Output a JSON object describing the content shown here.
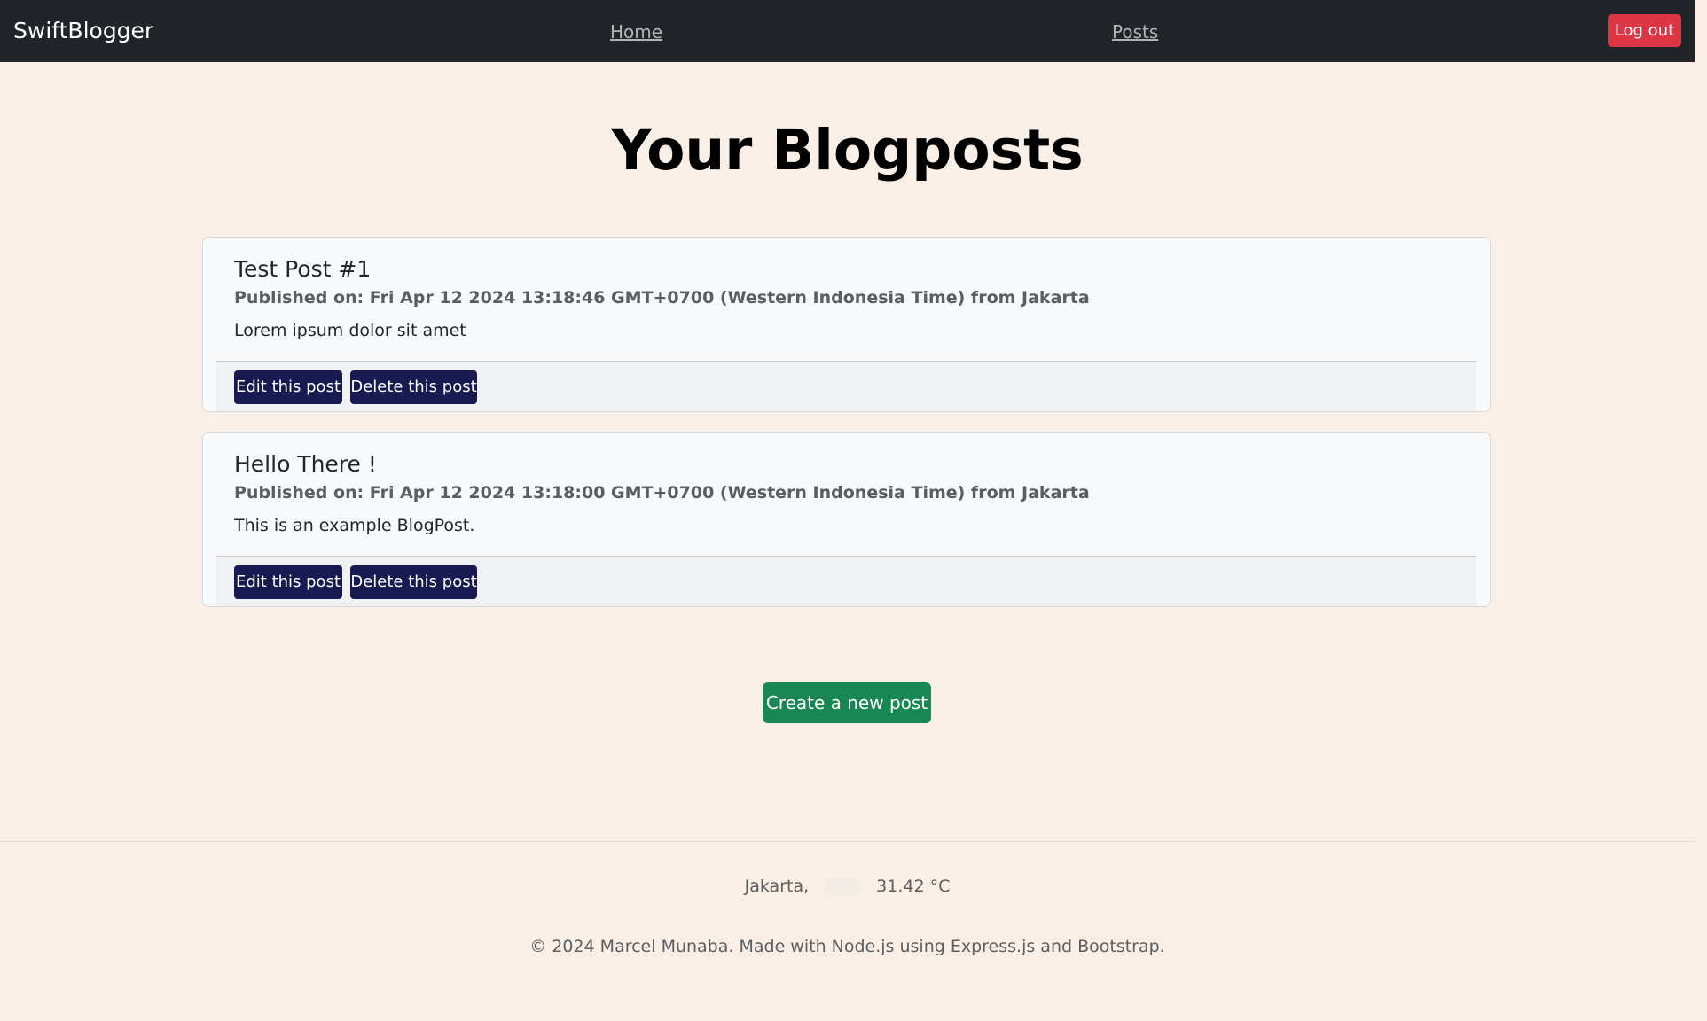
{
  "navbar": {
    "brand": "SwiftBlogger",
    "links": [
      {
        "label": "Home"
      },
      {
        "label": "Posts"
      }
    ],
    "logout_label": "Log out"
  },
  "page": {
    "title": "Your Blogposts"
  },
  "posts": [
    {
      "title": "Test Post #1",
      "published": "Published on: Fri Apr 12 2024 13:18:46 GMT+0700 (Western Indonesia Time) from Jakarta",
      "body": "Lorem ipsum dolor sit amet",
      "edit_label": "Edit this post",
      "delete_label": "Delete this post"
    },
    {
      "title": "Hello There !",
      "published": "Published on: Fri Apr 12 2024 13:18:00 GMT+0700 (Western Indonesia Time) from Jakarta",
      "body": "This is an example BlogPost.",
      "edit_label": "Edit this post",
      "delete_label": "Delete this post"
    }
  ],
  "create_label": "Create a new post",
  "footer": {
    "city": "Jakarta,",
    "weather_icon": "weather-icon",
    "temperature": "31.42 °C",
    "copyright": "© 2024 Marcel Munaba. Made with Node.js using Express.js and Bootstrap."
  },
  "colors": {
    "navbar_bg": "#212529",
    "page_bg": "#faefe6",
    "logout_red": "#dc3545",
    "post_button_navy": "#1a1a52",
    "create_green": "#198754"
  }
}
